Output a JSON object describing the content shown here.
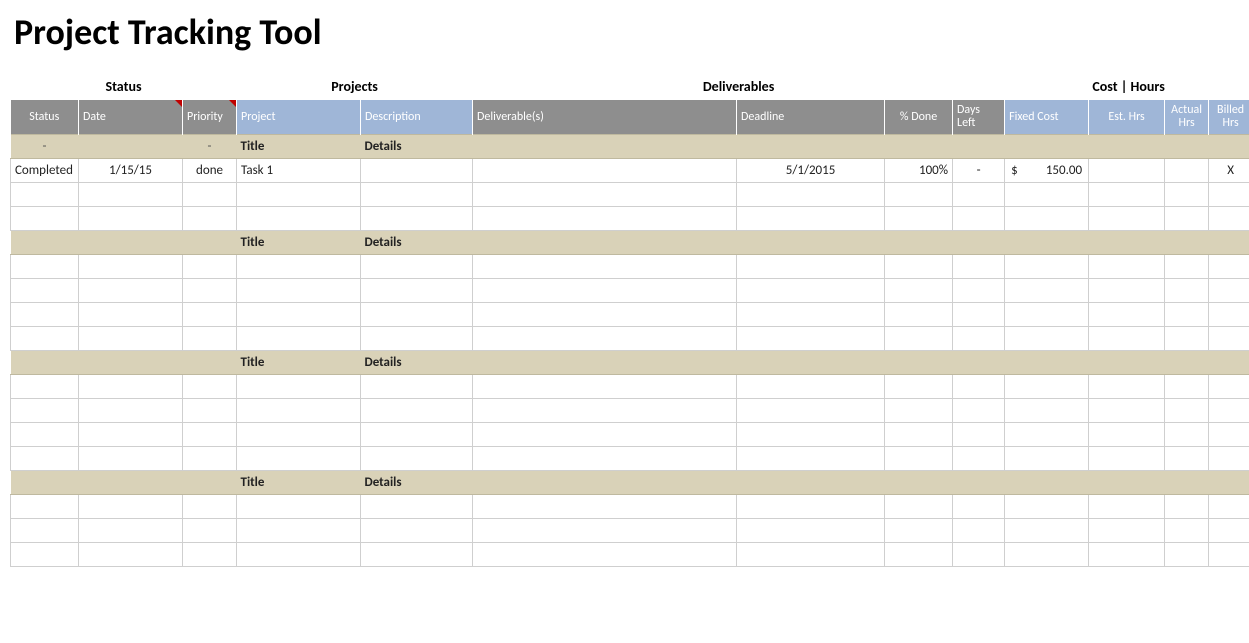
{
  "title": "Project Tracking Tool",
  "groupHeaders": {
    "status": "Status",
    "projects": "Projects",
    "deliverables": "Deliverables",
    "costHours": "Cost | Hours"
  },
  "columns": {
    "status": "Status",
    "date": "Date",
    "priority": "Priority",
    "project": "Project",
    "description": "Description",
    "deliverable": "Deliverable(s)",
    "deadline": "Deadline",
    "pctDone": "% Done",
    "daysLeft": "Days Left",
    "fixedCost": "Fixed Cost",
    "estHrs": "Est. Hrs",
    "actualHrs": "Actual Hrs",
    "billedHrs": "Billed Hrs"
  },
  "sectionLabels": {
    "title": "Title",
    "details": "Details",
    "dash": "-"
  },
  "row1": {
    "status": "Completed",
    "date": "1/15/15",
    "priority": "done",
    "project": "Task 1",
    "description": "",
    "deliverable": "",
    "deadline": "5/1/2015",
    "pctDone": "100%",
    "daysLeft": "-",
    "fixedCurrency": "$",
    "fixedAmount": "150.00",
    "estHrs": "",
    "actualHrs": "",
    "billedHrs": "X"
  }
}
